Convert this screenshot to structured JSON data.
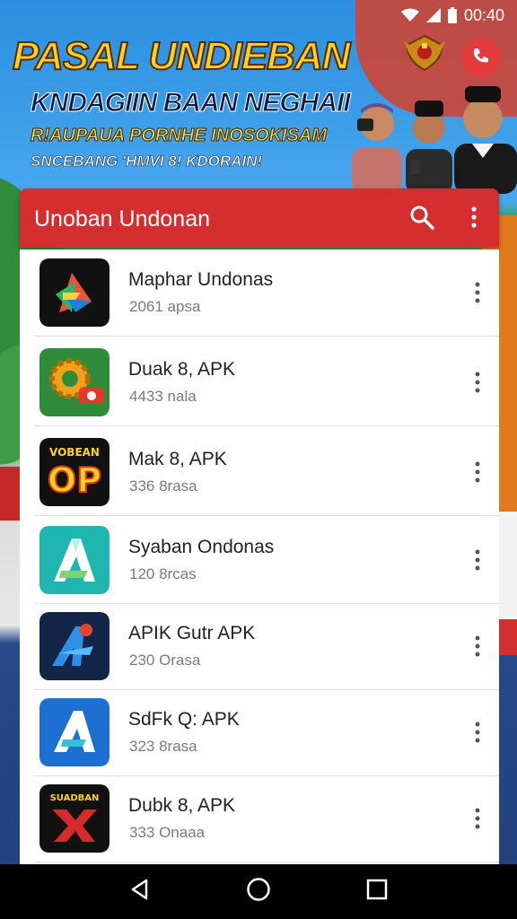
{
  "status_bar": {
    "time": "00:40",
    "icons": [
      "wifi-icon",
      "signal-icon",
      "battery-icon"
    ]
  },
  "banner": {
    "title": "PASAL UNDIEBAN",
    "subtitle1": "KNDAGIIN BAAN NEGHAII",
    "subtitle2": "R!AUPAUA PORNHE INOSOKISAM",
    "subtitle3": "SNCEBANG 'HMVI 8! KDORAIN!",
    "icons": [
      "emblem-icon",
      "phone-icon",
      "people-illustration"
    ]
  },
  "header": {
    "title": "Unoban Undonan",
    "icons": [
      "search-icon",
      "more-vert-icon"
    ],
    "color": "#d42e2e"
  },
  "apps": [
    {
      "name": "Maphar Undonas",
      "sub": "2061 apsa",
      "icon": "play-triangle-icon"
    },
    {
      "name": "Duak 8, APK",
      "sub": "4433 nala",
      "icon": "gear-icon"
    },
    {
      "name": "Mak 8, APK",
      "sub": "336 8rasa",
      "icon": "op-logo-icon",
      "icon_text": "VOBEAN",
      "icon_text2": "OP"
    },
    {
      "name": "Syaban Ondonas",
      "sub": "120 8rcas",
      "icon": "a-logo-icon"
    },
    {
      "name": "APIK Gutr APK",
      "sub": "230 Orasa",
      "icon": "a-arrow-icon"
    },
    {
      "name": "SdFk Q: APK",
      "sub": "323 8rasa",
      "icon": "a-blue-icon"
    },
    {
      "name": "Dubk 8, APK",
      "sub": "333 Onaaa",
      "icon": "x-logo-icon",
      "icon_text": "SUADBAN"
    }
  ],
  "nav_bar": {
    "icons": [
      "back-icon",
      "home-icon",
      "recents-icon"
    ]
  }
}
